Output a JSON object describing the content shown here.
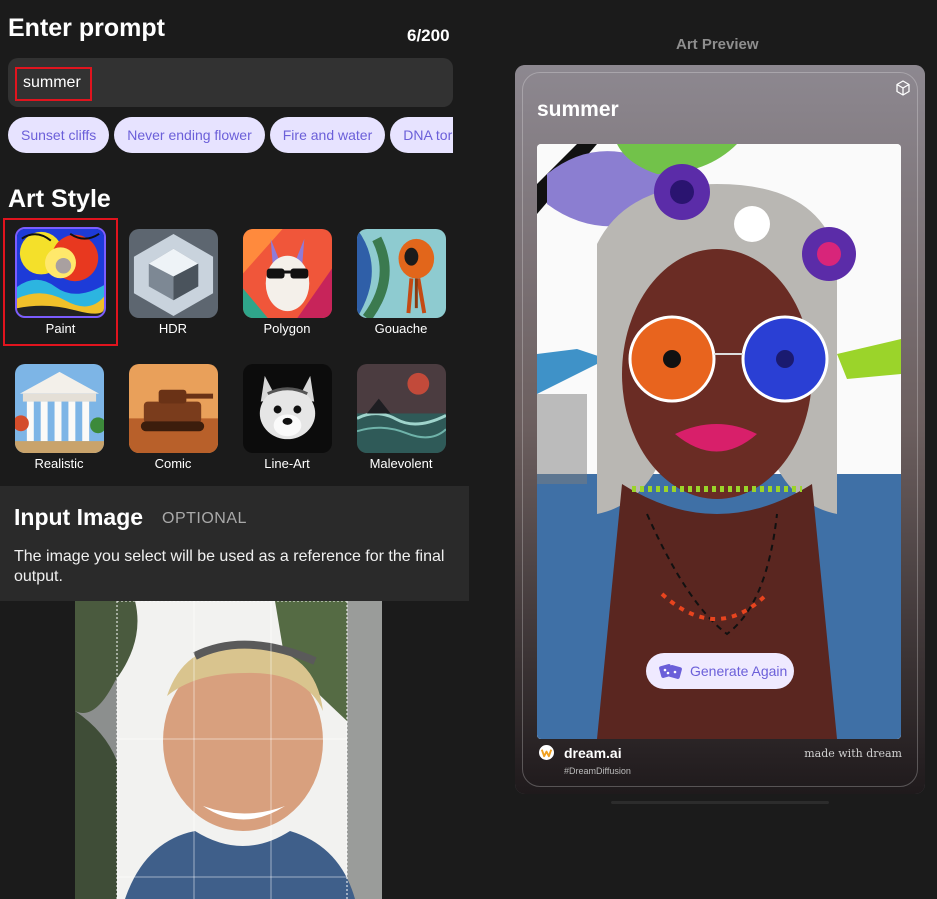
{
  "prompt": {
    "heading": "Enter prompt",
    "counter": "6/200",
    "value": "summer",
    "suggestions": [
      "Sunset cliffs",
      "Never ending flower",
      "Fire and water",
      "DNA tornado"
    ]
  },
  "art_style": {
    "heading": "Art Style",
    "selected": "Paint",
    "styles": [
      {
        "label": "Paint",
        "icon": "paint-thumbnail"
      },
      {
        "label": "HDR",
        "icon": "hdr-thumbnail"
      },
      {
        "label": "Polygon",
        "icon": "polygon-thumbnail"
      },
      {
        "label": "Gouache",
        "icon": "gouache-thumbnail"
      },
      {
        "label": "Realistic",
        "icon": "realistic-thumbnail"
      },
      {
        "label": "Comic",
        "icon": "comic-thumbnail"
      },
      {
        "label": "Line-Art",
        "icon": "line-art-thumbnail"
      },
      {
        "label": "Malevolent",
        "icon": "malevolent-thumbnail"
      }
    ]
  },
  "input_image": {
    "heading": "Input Image",
    "optional": "OPTIONAL",
    "description": "The image you select will be used as a reference for the final output."
  },
  "preview": {
    "heading": "Art Preview",
    "prompt": "summer",
    "generate_again": "Generate Again",
    "brand": "dream.ai",
    "hashtag": "#DreamDiffusion",
    "made_with": "made with dream"
  },
  "colors": {
    "accent": "#6b5fd9",
    "chip_bg": "#e7e3ff",
    "highlight": "#e0141e",
    "background": "#1b1b1b"
  }
}
